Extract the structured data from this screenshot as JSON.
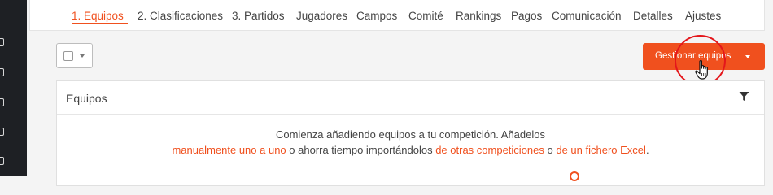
{
  "tabs": [
    {
      "label": "1. Equipos",
      "active": true
    },
    {
      "label": "2. Clasificaciones"
    },
    {
      "label": "3. Partidos"
    },
    {
      "label": "Jugadores"
    },
    {
      "label": "Campos"
    },
    {
      "label": "Comité"
    },
    {
      "label": "Rankings"
    },
    {
      "label": "Pagos"
    },
    {
      "label": "Comunicación"
    },
    {
      "label": "Detalles"
    },
    {
      "label": "Ajustes"
    }
  ],
  "toolbar": {
    "manage_label": "Gestionar equipos"
  },
  "panel": {
    "title": "Equipos",
    "empty_line1": "Comienza añadiendo equipos a tu competición. Añadelos",
    "link_manual": "manualmente uno a uno",
    "text_or1": " o ahorra tiempo importándolos ",
    "link_other": "de otras competiciones",
    "text_or2": " o ",
    "link_excel": "de un fichero Excel",
    "text_end": "."
  },
  "colors": {
    "accent": "#f0501e",
    "highlight": "#e4161b",
    "sidebar": "#1e2024"
  },
  "icons": [
    "filter-icon",
    "hand-pointer-icon",
    "chevron-down-icon"
  ]
}
